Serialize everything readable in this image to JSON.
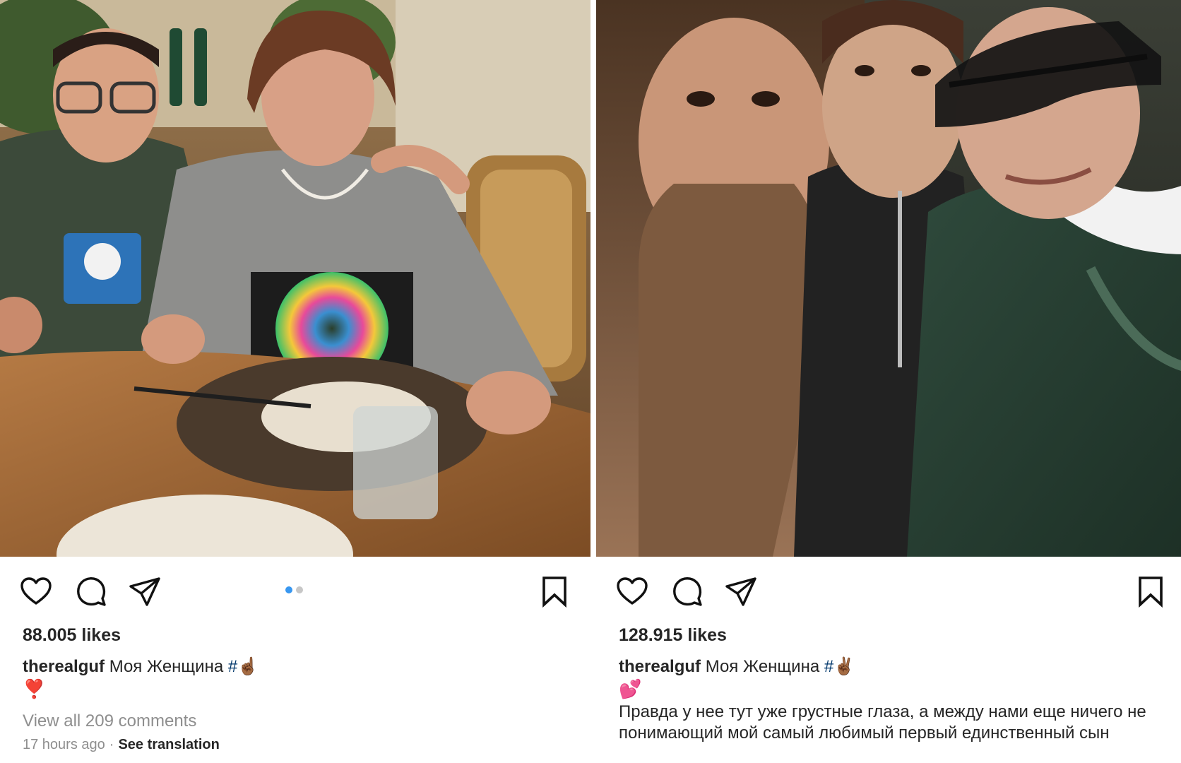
{
  "posts": [
    {
      "likes": "88.005 likes",
      "username": "therealguf",
      "caption_text": "Моя Женщина",
      "hashtag": "#",
      "caption_emoji": "☝🏾",
      "emoji_line": "❣️",
      "comments_link": "View all 209 comments",
      "timestamp": "17 hours ago",
      "separator": "·",
      "translation_link": "See translation",
      "carousel": {
        "count": 2,
        "active": 1
      },
      "icons": [
        "heart-icon",
        "comment-icon",
        "share-icon",
        "bookmark-icon"
      ]
    },
    {
      "likes": "128.915 likes",
      "username": "therealguf",
      "caption_text": "Моя Женщина",
      "hashtag": "#",
      "caption_emoji": "✌🏾",
      "emoji_line": "💕",
      "extra_text": "Правда у нее тут уже грустные глаза, а между нами еще ничего не понимающий мой самый любимый первый единственный сын",
      "icons": [
        "heart-icon",
        "comment-icon",
        "share-icon",
        "bookmark-icon"
      ]
    }
  ],
  "colors": {
    "hashtag": "#00376b",
    "secondary_text": "#8e8e8e",
    "carousel_active": "#3897f0"
  }
}
